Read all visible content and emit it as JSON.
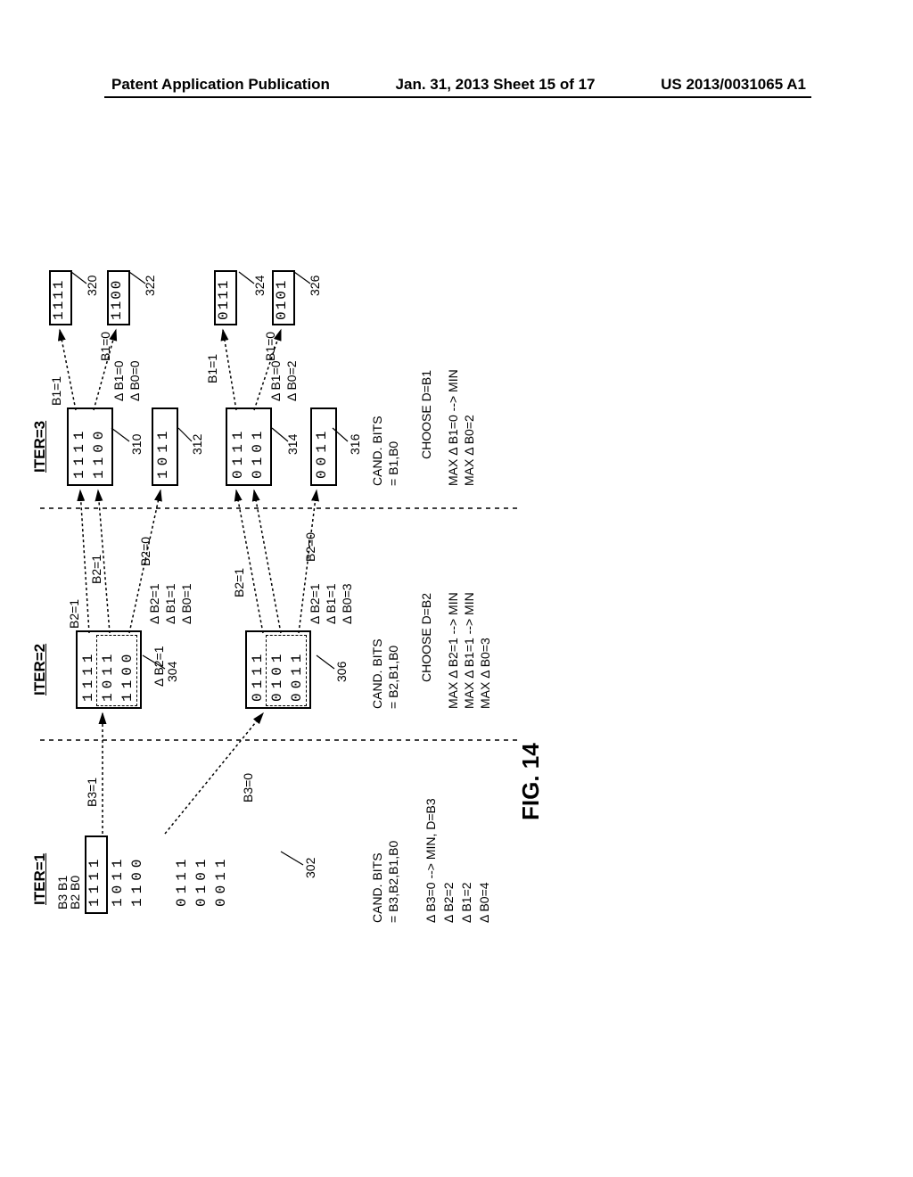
{
  "header": {
    "left": "Patent Application Publication",
    "center": "Jan. 31, 2013  Sheet 15 of 17",
    "right": "US 2013/0031065 A1"
  },
  "fig_label": "FIG. 14",
  "iter1": {
    "title": "ITER=1",
    "bitheader": "B3 B1\nB2 B0",
    "rows": [
      "1111",
      "1011",
      "1100",
      "0111",
      "0101",
      "0011"
    ],
    "ref": "302",
    "cand_label": "CAND. BITS",
    "cand_val": "= B3,B2,B1,B0",
    "deltas": [
      "Δ B3=0 --> MIN, D=B3",
      "Δ B2=2",
      "Δ B1=2",
      "Δ B0=4"
    ],
    "branch_top": "B3=1",
    "branch_bot": "B3=0"
  },
  "iter2": {
    "title": "ITER=2",
    "group1": [
      "1111",
      "1011",
      "1100"
    ],
    "group2": [
      "0111",
      "0101",
      "0011"
    ],
    "ref1": "304",
    "ref2": "306",
    "deltas1": [
      "Δ B2=1",
      "Δ B1=1",
      "Δ B0=1"
    ],
    "deltas2": [
      "Δ B2=1",
      "Δ B1=1",
      "Δ B0=3"
    ],
    "cand_label": "CAND. BITS",
    "cand_val": "=  B2,B1,B0",
    "choose": "CHOOSE D=B2",
    "maxes": [
      "MAX Δ B2=1 --> MIN",
      "MAX Δ B1=1 --> MIN",
      "MAX Δ B0=3"
    ],
    "b_top_a": "B2=1",
    "b_top_b": "B2=1",
    "b_top_c": "B2=0",
    "b_bot_a": "B2=1",
    "b_bot_b": "B2=0"
  },
  "iter3": {
    "title": "ITER=3",
    "group1": [
      "1111",
      "1100"
    ],
    "row2": "1011",
    "group3": [
      "0111",
      "0101"
    ],
    "row4": "0011",
    "ref1": "310",
    "ref2": "312",
    "ref3": "314",
    "ref4": "316",
    "deltas1": [
      "Δ B1=0",
      "Δ B0=0"
    ],
    "deltas3": [
      "Δ B1=0",
      "Δ B0=2"
    ],
    "cand_label": "CAND. BITS",
    "cand_val": "=  B1,B0",
    "choose": "CHOOSE D=B1",
    "maxes": [
      "MAX Δ B1=0 --> MIN",
      "MAX Δ B0=2"
    ],
    "b1a": "B1=1",
    "b1b": "B1=0",
    "b1c": "B1=1",
    "b1d": "B1=0"
  },
  "final": {
    "r1": "1111",
    "r2": "1100",
    "r3": "0111",
    "r4": "0101",
    "ref1": "320",
    "ref2": "322",
    "ref3": "324",
    "ref4": "326"
  }
}
